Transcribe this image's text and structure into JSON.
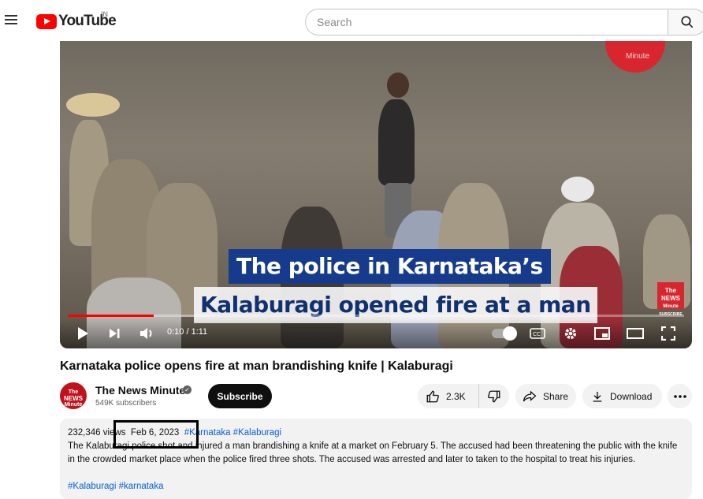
{
  "header": {
    "logo_text": "YouTube",
    "country_code": "IN",
    "search_placeholder": "Search",
    "icons": [
      "menu-icon",
      "search-icon"
    ]
  },
  "player": {
    "caption_line1": "The police in Karnataka’s",
    "caption_line2": "Kalaburagi opened fire at a man",
    "watermark": "Minute",
    "corner_logo_lines": [
      "The",
      "NEWS",
      "Minute",
      "SUBSCRIBE"
    ],
    "current_time": "0:10",
    "duration": "1:11",
    "time_display": "0:10 / 1:11",
    "progress_fraction": 0.14,
    "controls": [
      "play-icon",
      "next-icon",
      "volume-icon",
      "autoplay-toggle",
      "captions-icon",
      "settings-icon",
      "miniplayer-icon",
      "theater-icon",
      "fullscreen-icon"
    ]
  },
  "video": {
    "title": "Karnataka police opens fire at man brandishing knife | Kalaburagi"
  },
  "channel": {
    "name": "The News Minute",
    "subscribers": "549K subscribers",
    "avatar_lines": [
      "The",
      "NEWS",
      "Minute"
    ],
    "subscribe_label": "Subscribe"
  },
  "actions": {
    "likes": "2.3K",
    "share_label": "Share",
    "download_label": "Download"
  },
  "description": {
    "views": "232,346 views",
    "date": "Feb 6, 2023",
    "hashtags_top": "#Karnataka #Kalaburagi",
    "body": "The Kalaburagi police shot and injured a man brandishing a knife at a market on February 5. The accused had been threatening the public with the knife in the crowded market place when the police fired three shots. The accused was arrested and later to taken to the hospital to treat his injuries.",
    "hashtags_bottom": "#Kalaburagi #karnataka"
  },
  "colors": {
    "brand_red": "#ff0000",
    "link_blue": "#065fd4",
    "caption_blue": "#173b8c"
  }
}
